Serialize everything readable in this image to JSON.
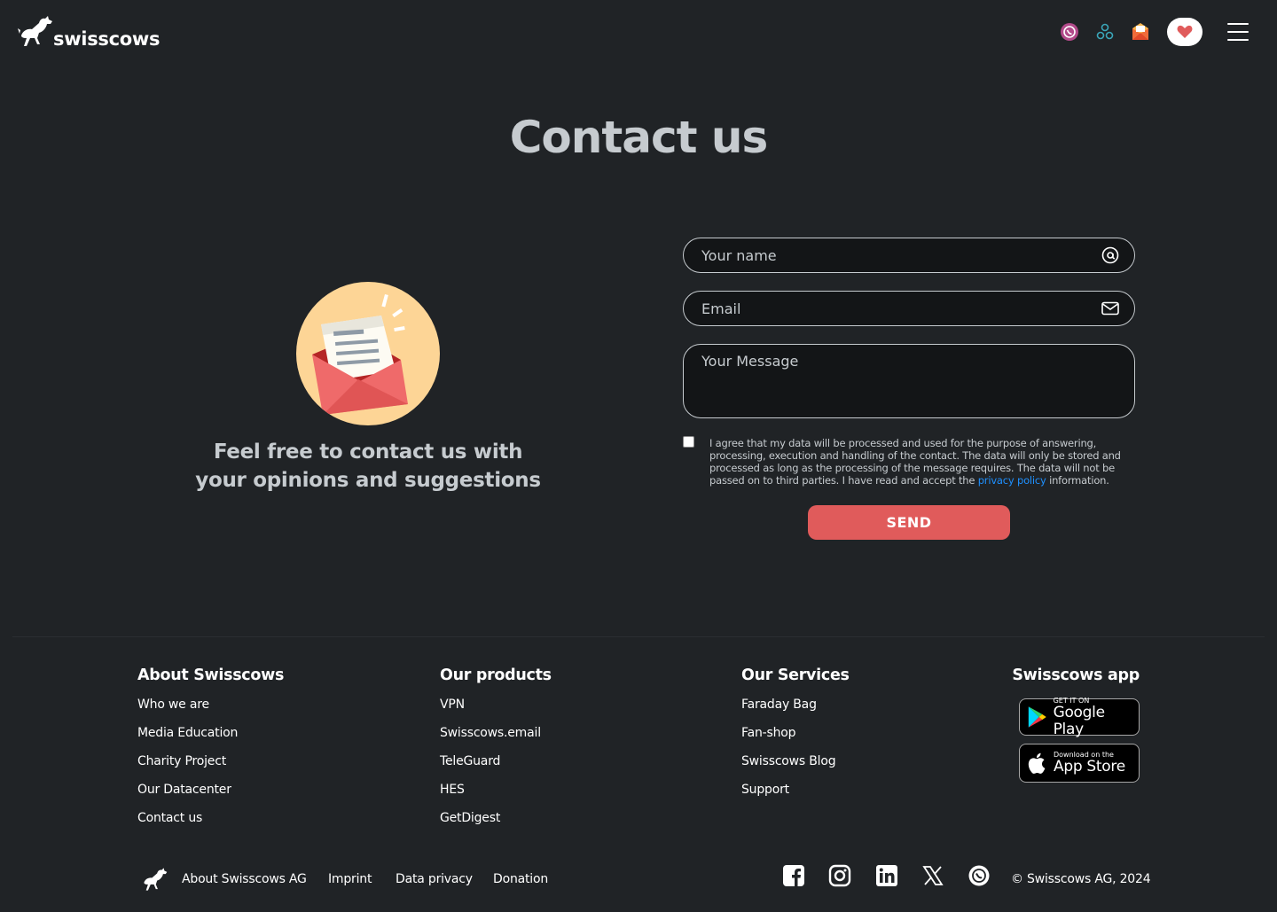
{
  "header": {
    "logo_text": "swisscows",
    "icons": [
      "teleguard-icon",
      "vpn-icon",
      "email-icon",
      "heart-icon",
      "menu-icon"
    ]
  },
  "main": {
    "title": "Contact us",
    "tagline": "Feel free to contact us with your opinions and suggestions"
  },
  "form": {
    "name_placeholder": "Your name",
    "email_placeholder": "Email",
    "message_placeholder": "Your Message",
    "consent_before": "I agree that my data will be processed and used for the purpose of answering, processing, execution and handling of the contact. The data will only be stored and processed as long as the processing of the message requires. The data will not be passed on to third parties. I have read and accept the ",
    "consent_link": "privacy policy",
    "consent_after": " information.",
    "send_label": "SEND"
  },
  "footer": {
    "about": {
      "title": "About Swisscows",
      "links": [
        "Who we are",
        "Media Education",
        "Charity Project",
        "Our Datacenter",
        "Contact us"
      ]
    },
    "products": {
      "title": "Our products",
      "links": [
        "VPN",
        "Swisscows.email",
        "TeleGuard",
        "HES",
        "GetDigest"
      ]
    },
    "services": {
      "title": "Our Services",
      "links": [
        "Faraday Bag",
        "Fan-shop",
        "Swisscows Blog",
        "Support"
      ]
    },
    "app": {
      "title": "Swisscows app",
      "google_small": "GET IT ON",
      "google_big": "Google Play",
      "apple_small": "Download on the",
      "apple_big": "App Store"
    },
    "bottom": {
      "links": [
        "About Swisscows AG",
        "Imprint",
        "Data privacy",
        "Donation"
      ],
      "social": [
        "facebook-icon",
        "instagram-icon",
        "linkedin-icon",
        "x-icon",
        "teleguard-icon"
      ],
      "copyright": "© Swisscows AG, 2024"
    }
  },
  "colors": {
    "background": "#202326",
    "accent": "#e05b5b",
    "link": "#1e90ff",
    "muted_text": "#c6cbcf"
  }
}
